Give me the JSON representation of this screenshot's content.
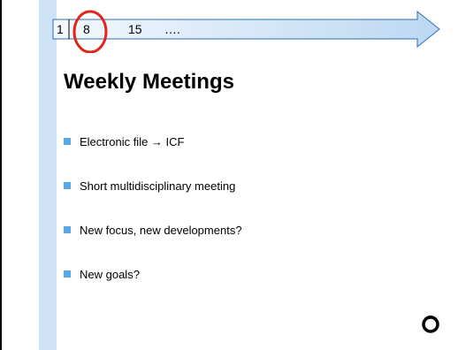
{
  "timeline": {
    "items": [
      "1",
      "8",
      "15",
      "…."
    ],
    "highlighted": "8"
  },
  "title": "Weekly Meetings",
  "bullets": [
    "Electronic file → ICF",
    "Short multidisciplinary meeting",
    "New focus, new developments?",
    "New goals?"
  ],
  "colors": {
    "accent_bar": "#cfe3f6",
    "bullet": "#58a8e8",
    "highlight_circle": "#e0261b",
    "arrow_outline": "#2b6fb3"
  },
  "icons": {
    "logo": "organization-logo-icon"
  }
}
